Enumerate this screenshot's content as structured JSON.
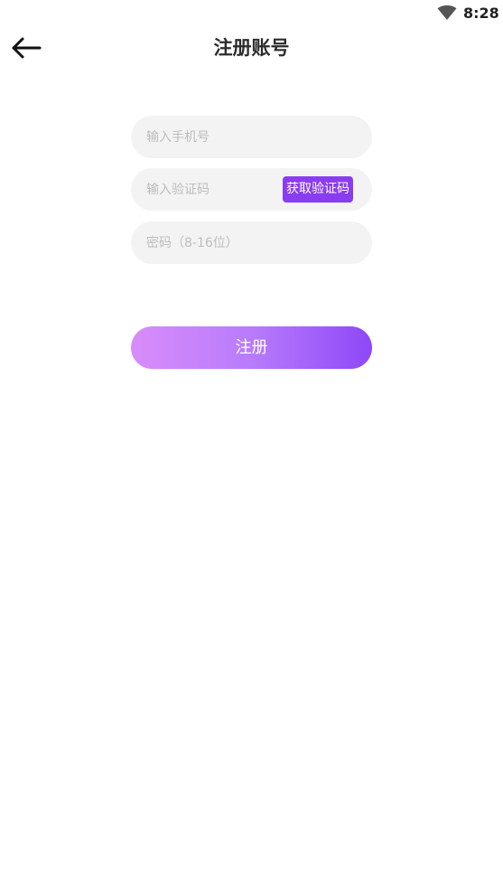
{
  "status_bar": {
    "time": "8:28",
    "wifi_icon": "wifi-icon"
  },
  "header": {
    "back_icon": "arrow-left-icon",
    "title": "注册账号"
  },
  "form": {
    "phone": {
      "placeholder": "输入手机号",
      "value": ""
    },
    "code": {
      "placeholder": "输入验证码",
      "value": "",
      "get_code_label": "获取验证码"
    },
    "password": {
      "placeholder": "密码（8-16位）",
      "value": ""
    },
    "submit_label": "注册"
  },
  "colors": {
    "accent": "#8a3df0",
    "gradient_start": "#d88cfb",
    "gradient_end": "#8e48f8",
    "field_bg": "#f3f3f3"
  }
}
